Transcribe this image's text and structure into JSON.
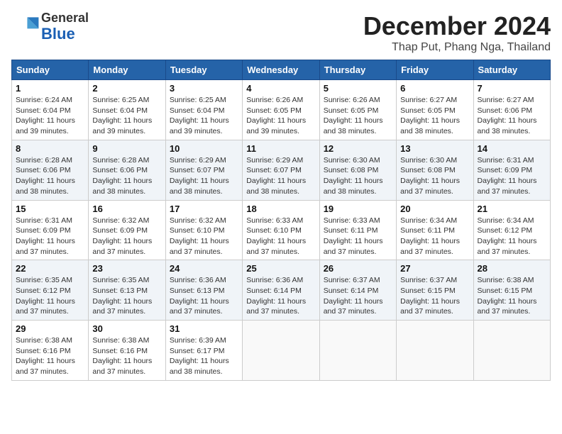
{
  "header": {
    "logo_general": "General",
    "logo_blue": "Blue",
    "month": "December 2024",
    "location": "Thap Put, Phang Nga, Thailand"
  },
  "days_of_week": [
    "Sunday",
    "Monday",
    "Tuesday",
    "Wednesday",
    "Thursday",
    "Friday",
    "Saturday"
  ],
  "weeks": [
    [
      {
        "day": 1,
        "sunrise": "6:24 AM",
        "sunset": "6:04 PM",
        "daylight": "11 hours and 39 minutes."
      },
      {
        "day": 2,
        "sunrise": "6:25 AM",
        "sunset": "6:04 PM",
        "daylight": "11 hours and 39 minutes."
      },
      {
        "day": 3,
        "sunrise": "6:25 AM",
        "sunset": "6:04 PM",
        "daylight": "11 hours and 39 minutes."
      },
      {
        "day": 4,
        "sunrise": "6:26 AM",
        "sunset": "6:05 PM",
        "daylight": "11 hours and 39 minutes."
      },
      {
        "day": 5,
        "sunrise": "6:26 AM",
        "sunset": "6:05 PM",
        "daylight": "11 hours and 38 minutes."
      },
      {
        "day": 6,
        "sunrise": "6:27 AM",
        "sunset": "6:05 PM",
        "daylight": "11 hours and 38 minutes."
      },
      {
        "day": 7,
        "sunrise": "6:27 AM",
        "sunset": "6:06 PM",
        "daylight": "11 hours and 38 minutes."
      }
    ],
    [
      {
        "day": 8,
        "sunrise": "6:28 AM",
        "sunset": "6:06 PM",
        "daylight": "11 hours and 38 minutes."
      },
      {
        "day": 9,
        "sunrise": "6:28 AM",
        "sunset": "6:06 PM",
        "daylight": "11 hours and 38 minutes."
      },
      {
        "day": 10,
        "sunrise": "6:29 AM",
        "sunset": "6:07 PM",
        "daylight": "11 hours and 38 minutes."
      },
      {
        "day": 11,
        "sunrise": "6:29 AM",
        "sunset": "6:07 PM",
        "daylight": "11 hours and 38 minutes."
      },
      {
        "day": 12,
        "sunrise": "6:30 AM",
        "sunset": "6:08 PM",
        "daylight": "11 hours and 38 minutes."
      },
      {
        "day": 13,
        "sunrise": "6:30 AM",
        "sunset": "6:08 PM",
        "daylight": "11 hours and 37 minutes."
      },
      {
        "day": 14,
        "sunrise": "6:31 AM",
        "sunset": "6:09 PM",
        "daylight": "11 hours and 37 minutes."
      }
    ],
    [
      {
        "day": 15,
        "sunrise": "6:31 AM",
        "sunset": "6:09 PM",
        "daylight": "11 hours and 37 minutes."
      },
      {
        "day": 16,
        "sunrise": "6:32 AM",
        "sunset": "6:09 PM",
        "daylight": "11 hours and 37 minutes."
      },
      {
        "day": 17,
        "sunrise": "6:32 AM",
        "sunset": "6:10 PM",
        "daylight": "11 hours and 37 minutes."
      },
      {
        "day": 18,
        "sunrise": "6:33 AM",
        "sunset": "6:10 PM",
        "daylight": "11 hours and 37 minutes."
      },
      {
        "day": 19,
        "sunrise": "6:33 AM",
        "sunset": "6:11 PM",
        "daylight": "11 hours and 37 minutes."
      },
      {
        "day": 20,
        "sunrise": "6:34 AM",
        "sunset": "6:11 PM",
        "daylight": "11 hours and 37 minutes."
      },
      {
        "day": 21,
        "sunrise": "6:34 AM",
        "sunset": "6:12 PM",
        "daylight": "11 hours and 37 minutes."
      }
    ],
    [
      {
        "day": 22,
        "sunrise": "6:35 AM",
        "sunset": "6:12 PM",
        "daylight": "11 hours and 37 minutes."
      },
      {
        "day": 23,
        "sunrise": "6:35 AM",
        "sunset": "6:13 PM",
        "daylight": "11 hours and 37 minutes."
      },
      {
        "day": 24,
        "sunrise": "6:36 AM",
        "sunset": "6:13 PM",
        "daylight": "11 hours and 37 minutes."
      },
      {
        "day": 25,
        "sunrise": "6:36 AM",
        "sunset": "6:14 PM",
        "daylight": "11 hours and 37 minutes."
      },
      {
        "day": 26,
        "sunrise": "6:37 AM",
        "sunset": "6:14 PM",
        "daylight": "11 hours and 37 minutes."
      },
      {
        "day": 27,
        "sunrise": "6:37 AM",
        "sunset": "6:15 PM",
        "daylight": "11 hours and 37 minutes."
      },
      {
        "day": 28,
        "sunrise": "6:38 AM",
        "sunset": "6:15 PM",
        "daylight": "11 hours and 37 minutes."
      }
    ],
    [
      {
        "day": 29,
        "sunrise": "6:38 AM",
        "sunset": "6:16 PM",
        "daylight": "11 hours and 37 minutes."
      },
      {
        "day": 30,
        "sunrise": "6:38 AM",
        "sunset": "6:16 PM",
        "daylight": "11 hours and 37 minutes."
      },
      {
        "day": 31,
        "sunrise": "6:39 AM",
        "sunset": "6:17 PM",
        "daylight": "11 hours and 38 minutes."
      },
      null,
      null,
      null,
      null
    ]
  ]
}
